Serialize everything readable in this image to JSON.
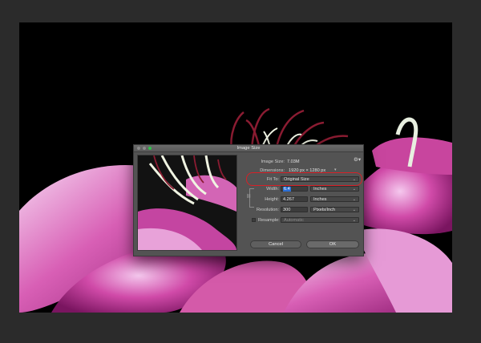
{
  "dialog": {
    "title": "Image Size",
    "image_size_label": "Image Size:",
    "image_size_value": "7.03M",
    "dimensions_label": "Dimensions:",
    "dimensions_value": "1920 px  ×  1280 px",
    "fit_to_label": "Fit To:",
    "fit_to_value": "Original Size",
    "width_label": "Width:",
    "width_value": "6.4",
    "width_unit": "Inches",
    "height_label": "Height:",
    "height_value": "4.267",
    "height_unit": "Inches",
    "resolution_label": "Resolution:",
    "resolution_value": "300",
    "resolution_unit": "Pixels/Inch",
    "resample_label": "Resample:",
    "resample_value": "Automatic",
    "cancel_label": "Cancel",
    "ok_label": "OK"
  },
  "colors": {
    "annotation_ring": "#d82027",
    "zoom_green": "#2fc24a",
    "selection_blue": "#2a6fd6"
  },
  "icons": {
    "settings": "gear-icon",
    "dropdown": "chevron-down-icon",
    "constrain": "link-icon"
  }
}
